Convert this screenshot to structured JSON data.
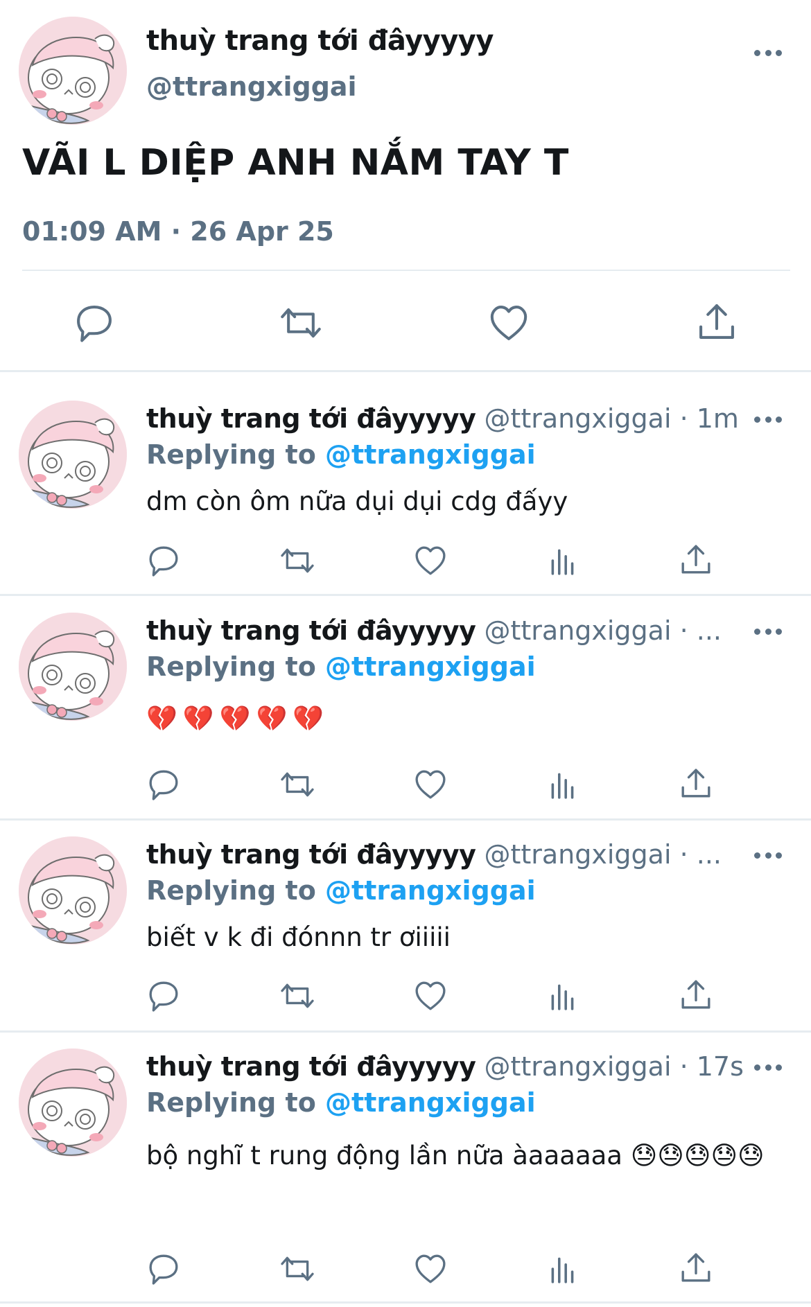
{
  "main_tweet": {
    "display_name": "thuỳ trang tới đâyyyyy",
    "handle": "@ttrangxiggai",
    "text": "VÃI L DIỆP ANH NẮM TAY T",
    "timestamp": "01:09 AM · 26 Apr 25",
    "actions": [
      "reply-icon",
      "retweet-icon",
      "like-icon",
      "share-icon"
    ]
  },
  "replies": [
    {
      "display_name": "thuỳ trang tới đâyyyyy",
      "handle": "@ttrangxiggai",
      "time": "· 1m",
      "replying_label": "Replying to",
      "replying_to": "@ttrangxiggai",
      "text": "dm còn ôm nữa dụi dụi cdg đấyy"
    },
    {
      "display_name": "thuỳ trang tới đâyyyyy",
      "handle": "@ttrangxiggai",
      "time": "· ...",
      "replying_label": "Replying to",
      "replying_to": "@ttrangxiggai",
      "text": "💔💔💔💔💔"
    },
    {
      "display_name": "thuỳ trang tới đâyyyyy",
      "handle": "@ttrangxiggai",
      "time": "· ...",
      "replying_label": "Replying to",
      "replying_to": "@ttrangxiggai",
      "text": "biết v k đi đónnn tr ơiiiii"
    },
    {
      "display_name": "thuỳ trang tới đâyyyyy",
      "handle": "@ttrangxiggai",
      "time": "· 17s",
      "replying_label": "Replying to",
      "replying_to": "@ttrangxiggai",
      "text": "bộ nghĩ t rung động lần nữa àaaaaaa 😓😓😓😓😓"
    }
  ],
  "reply_actions": [
    "reply-icon",
    "retweet-icon",
    "like-icon",
    "analytics-icon",
    "share-icon"
  ],
  "colors": {
    "text": "#14171a",
    "secondary": "#5b7083",
    "accent": "#1da1f2",
    "divider": "#e6ecf0",
    "avatar_bg": "#f6dbe1"
  }
}
